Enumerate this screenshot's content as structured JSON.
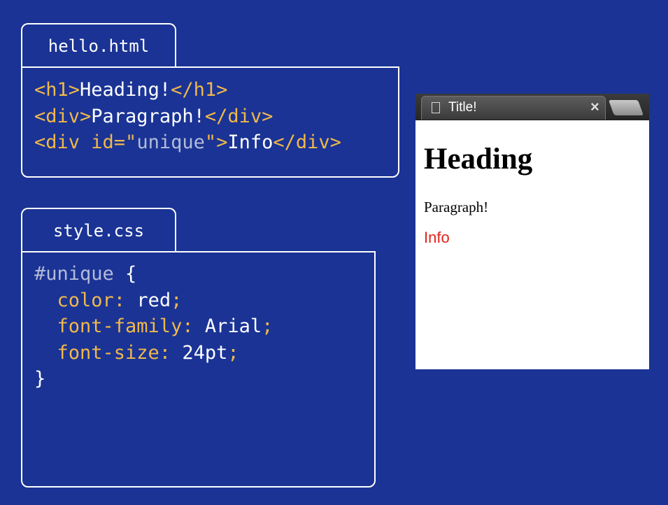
{
  "html_editor": {
    "filename": "hello.html",
    "lines": [
      [
        {
          "text": "<h1>",
          "style": "tag"
        },
        {
          "text": "Heading!",
          "style": "text"
        },
        {
          "text": "</h1>",
          "style": "tag"
        }
      ],
      [
        {
          "text": "<div>",
          "style": "tag"
        },
        {
          "text": "Paragraph!",
          "style": "text"
        },
        {
          "text": "</div>",
          "style": "tag"
        }
      ],
      [
        {
          "text": "<div id=\"",
          "style": "tag"
        },
        {
          "text": "unique",
          "style": "muted"
        },
        {
          "text": "\">",
          "style": "tag"
        },
        {
          "text": "Info",
          "style": "text"
        },
        {
          "text": "</div>",
          "style": "tag"
        }
      ]
    ]
  },
  "css_editor": {
    "filename": "style.css",
    "lines": [
      [
        {
          "text": "#unique ",
          "style": "muted"
        },
        {
          "text": "{",
          "style": "text"
        }
      ],
      [
        {
          "text": "  color: ",
          "style": "tag"
        },
        {
          "text": "red",
          "style": "text"
        },
        {
          "text": ";",
          "style": "tag"
        }
      ],
      [
        {
          "text": "  font-family: ",
          "style": "tag"
        },
        {
          "text": "Arial",
          "style": "text"
        },
        {
          "text": ";",
          "style": "tag"
        }
      ],
      [
        {
          "text": "  font-size: ",
          "style": "tag"
        },
        {
          "text": "24pt",
          "style": "text"
        },
        {
          "text": ";",
          "style": "tag"
        }
      ],
      [
        {
          "text": "}",
          "style": "text"
        }
      ]
    ]
  },
  "browser": {
    "tab_title": "Title!",
    "close_glyph": "×",
    "page": {
      "heading": "Heading",
      "paragraph": "Paragraph!",
      "info": "Info"
    }
  },
  "colors": {
    "background": "#1a3395",
    "tag": "#f0b84a",
    "text": "#ffffff",
    "muted": "#b4bbd8",
    "info_text": "#e2231a"
  },
  "icons": {
    "document": "document-icon",
    "close": "close-icon",
    "new_tab": "new-tab-icon"
  }
}
